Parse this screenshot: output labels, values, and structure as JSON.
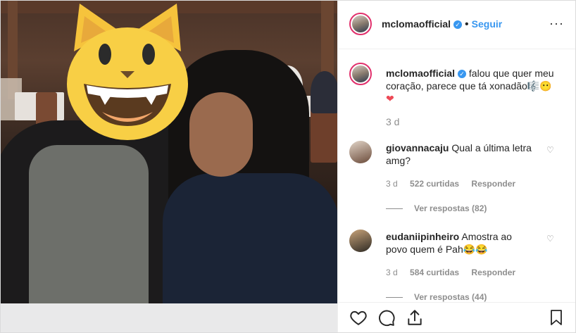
{
  "header": {
    "username": "mcloma​official",
    "separator": "•",
    "follow_label": "Seguir",
    "more_label": "···"
  },
  "caption": {
    "username": "mcloma​official",
    "text": "falou que quer meu coração, parece que tá xonadão🎼😶",
    "heart": "❤",
    "time": "3 d"
  },
  "comments": [
    {
      "username": "giovannacaju",
      "text": "Qual a última letra amg?",
      "time": "3 d",
      "likes": "522 curtidas",
      "reply_label": "Responder",
      "view_replies": "Ver respostas (82)"
    },
    {
      "username": "eudaniipinheiro",
      "text": "Amostra ao povo quem é Pah😂😂",
      "time": "3 d",
      "likes": "584 curtidas",
      "reply_label": "Responder",
      "view_replies": "Ver respostas (44)"
    }
  ],
  "icons": {
    "like": "heart-icon",
    "comment": "comment-icon",
    "share": "share-icon",
    "save": "bookmark-icon"
  },
  "colors": {
    "link_blue": "#3897f0",
    "verified_blue": "#3897f0",
    "muted": "#8e8e8e",
    "text": "#262626"
  }
}
